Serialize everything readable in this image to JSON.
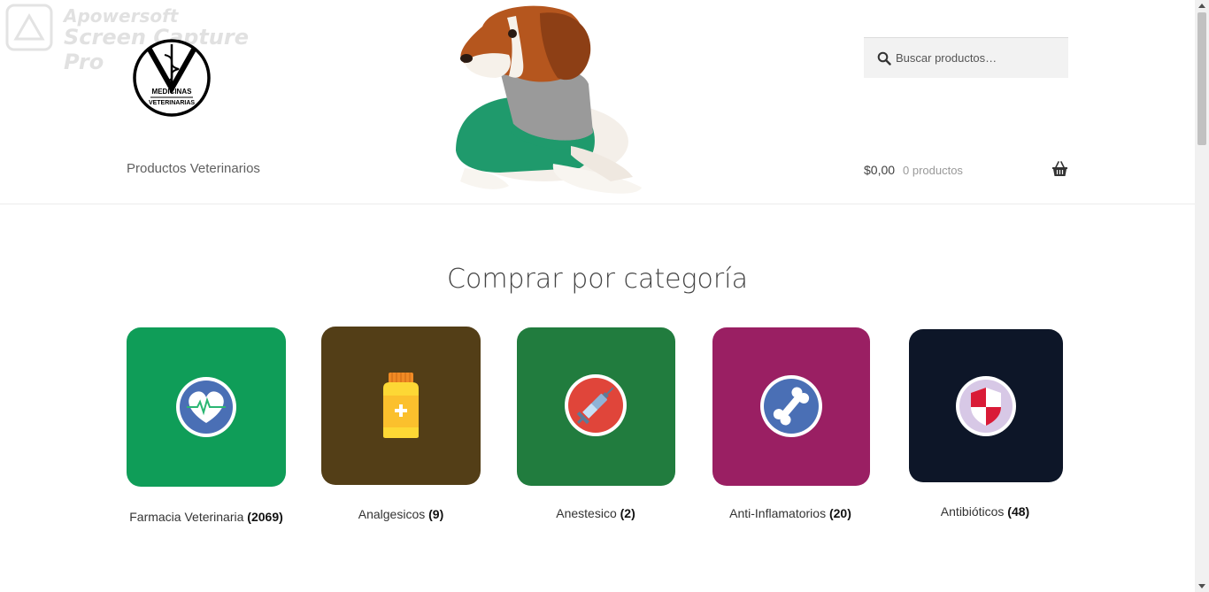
{
  "watermark": {
    "line1": "Apowersoft",
    "line2": "Screen Capture Pro"
  },
  "logo": {
    "text_top": "MEDICINAS",
    "text_bottom": "VETERINARIAS",
    "icon": "caduceus-v-logo"
  },
  "nav": {
    "label": "Productos Veterinarios"
  },
  "search": {
    "placeholder": "Buscar productos…",
    "icon": "search-icon"
  },
  "cart": {
    "amount": "$0,00",
    "count": "0 productos",
    "icon": "basket-icon"
  },
  "section": {
    "title": "Comprar por categoría"
  },
  "categories": [
    {
      "name": "Farmacia Veterinaria",
      "count": "(2069)",
      "color": "#0f9d58",
      "icon": "heart-pulse-icon"
    },
    {
      "name": "Analgesicos",
      "count": "(9)",
      "color": "#533e17",
      "icon": "pill-bottle-icon"
    },
    {
      "name": "Anestesico",
      "count": "(2)",
      "color": "#217c3e",
      "icon": "syringe-icon"
    },
    {
      "name": "Anti-Inflamatorios",
      "count": "(20)",
      "color": "#9a1f63",
      "icon": "bone-icon"
    },
    {
      "name": "Antibióticos",
      "count": "(48)",
      "color": "#0d1628",
      "icon": "shield-icon"
    }
  ]
}
